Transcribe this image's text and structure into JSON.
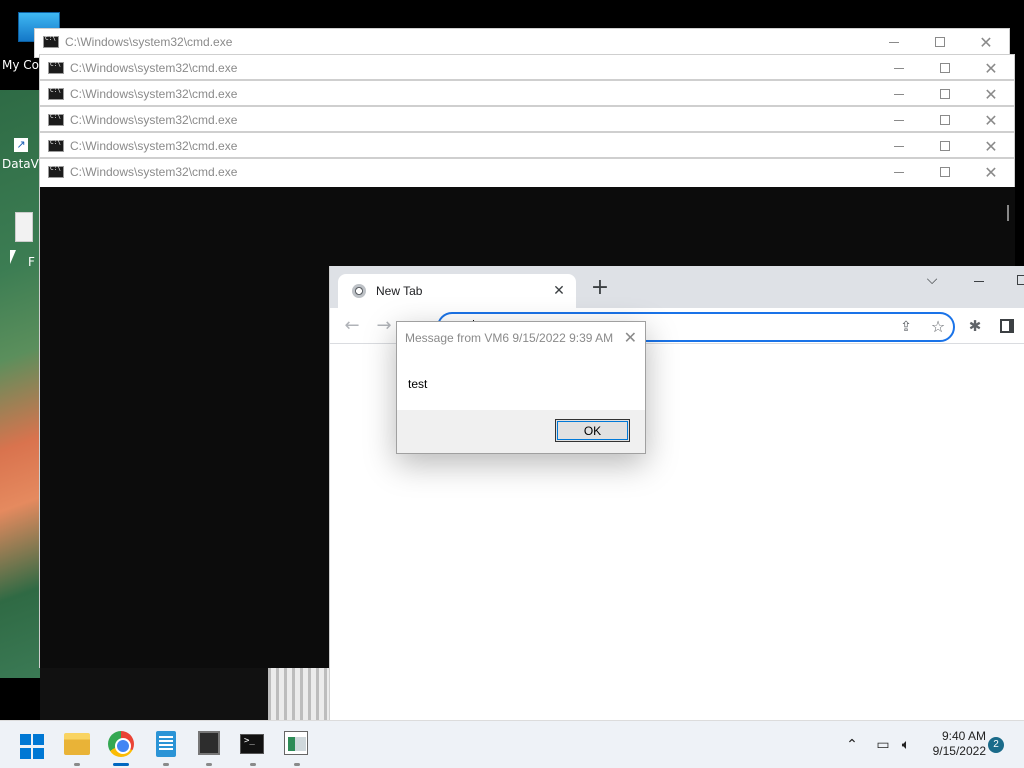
{
  "desktop": {
    "icons": [
      {
        "label": "My Co"
      },
      {
        "label": "DataV"
      },
      {
        "label": "F"
      }
    ]
  },
  "cmd_windows": [
    {
      "title": "C:\\Windows\\system32\\cmd.exe"
    },
    {
      "title": "C:\\Windows\\system32\\cmd.exe"
    },
    {
      "title": "C:\\Windows\\system32\\cmd.exe"
    },
    {
      "title": "C:\\Windows\\system32\\cmd.exe"
    },
    {
      "title": "C:\\Windows\\system32\\cmd.exe"
    },
    {
      "title": "C:\\Windows\\system32\\cmd.exe"
    }
  ],
  "chrome": {
    "tab_title": "New Tab",
    "tab_close": "✕",
    "new_tab": "+",
    "omnibox_value": ""
  },
  "message": {
    "title": "Message from VM6 9/15/2022 9:39 AM",
    "body": "test",
    "ok_label": "OK"
  },
  "taskbar": {
    "apps": [
      "windows-start",
      "file-explorer",
      "chrome",
      "notepad",
      "vim",
      "terminal",
      "app"
    ],
    "time": "9:40 AM",
    "date": "9/15/2022",
    "notification_count": "2"
  },
  "colors": {
    "accent": "#0078d4",
    "chrome_focus": "#1a73e8",
    "console_bg": "#0c0c0c"
  }
}
